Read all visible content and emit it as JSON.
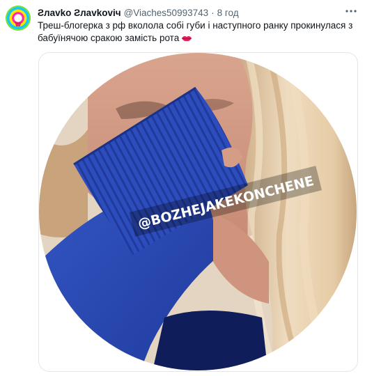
{
  "tweet": {
    "author_name": "Ƨлavko Ƨлavkoviч",
    "handle": "@Viaches50993743",
    "separator": "·",
    "time": "8 год",
    "more_icon": "more-icon",
    "text_line1": "Треш-блогерка з рф вколола собі губи і наступного ранку прокинулася з",
    "text_line2": "бабуїнячою сракою замість рота",
    "emoji_icon": "kiss-mark-icon",
    "media": {
      "watermark": "@BOZHEJAKEKONCHENE"
    }
  },
  "colors": {
    "text_primary": "#0f1419",
    "text_secondary": "#536471",
    "sweater_blue": "#2a49b8",
    "hair_blonde": "#e2c8a2",
    "media_border": "#e3e6e8"
  }
}
